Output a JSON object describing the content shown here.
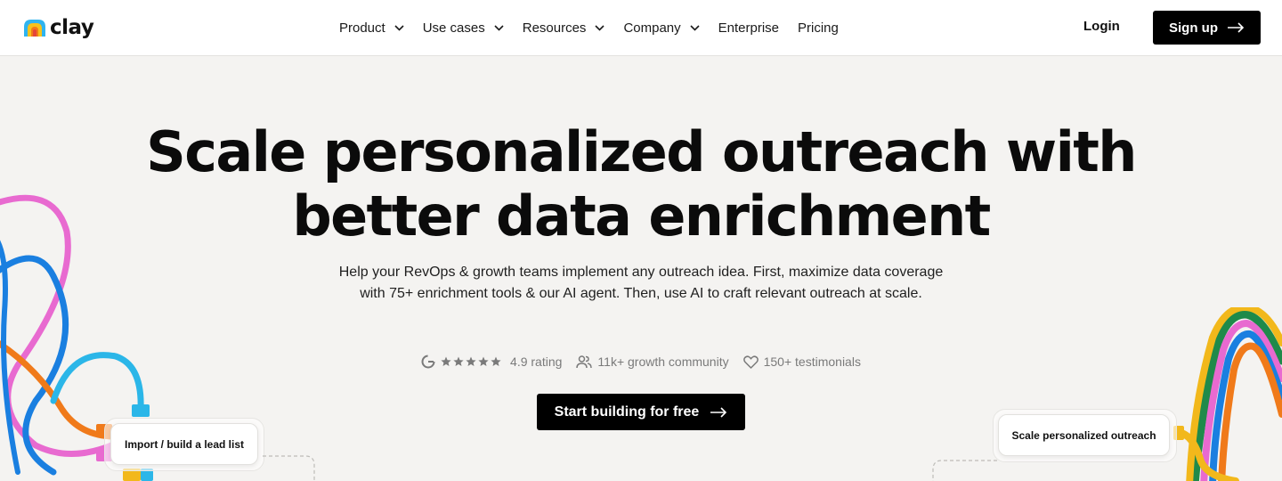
{
  "brand": {
    "name": "clay"
  },
  "nav": {
    "items": [
      {
        "label": "Product",
        "has_dropdown": true
      },
      {
        "label": "Use cases",
        "has_dropdown": true
      },
      {
        "label": "Resources",
        "has_dropdown": true
      },
      {
        "label": "Company",
        "has_dropdown": true
      },
      {
        "label": "Enterprise",
        "has_dropdown": false
      },
      {
        "label": "Pricing",
        "has_dropdown": false
      }
    ],
    "login_label": "Login",
    "signup_label": "Sign up"
  },
  "hero": {
    "title_line1": "Scale personalized outreach with",
    "title_line2": "better data enrichment",
    "subtitle": "Help your RevOps & growth teams implement any outreach idea. First, maximize data coverage with 75+ enrichment tools & our AI agent. Then, use AI to craft relevant outreach at scale.",
    "stats": {
      "rating": "4.9 rating",
      "stars": 5,
      "community": "11k+ growth community",
      "testimonials": "150+ testimonials"
    },
    "cta_label": "Start building for free"
  },
  "cards": {
    "left": "Import / build a lead list",
    "right": "Scale personalized outreach"
  },
  "colors": {
    "primary": "#000000",
    "background": "#f4f3f1",
    "cable_pink": "#e86ad0",
    "cable_blue": "#1a7fe0",
    "cable_cyan": "#2bb6e8",
    "cable_orange": "#f07a1a",
    "cable_green": "#1f8a4a",
    "cable_yellow": "#f2b81b"
  }
}
